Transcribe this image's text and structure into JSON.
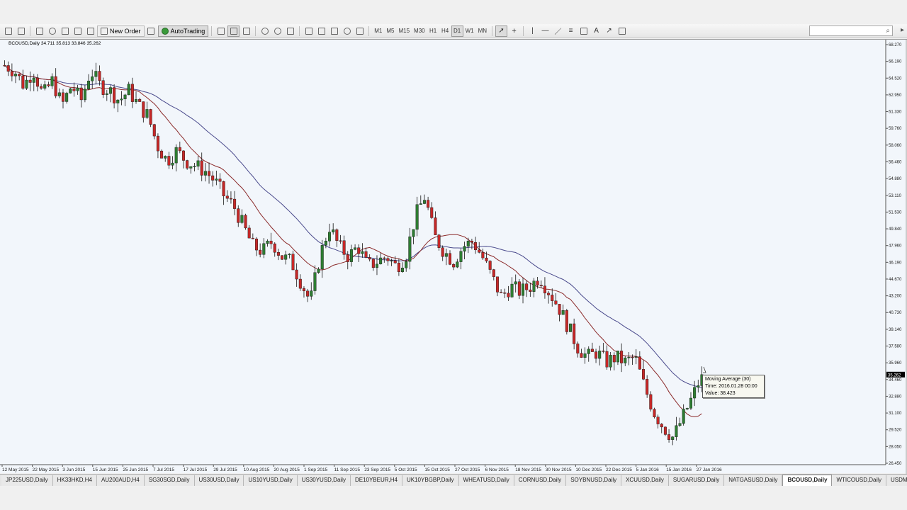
{
  "toolbar": {
    "new_order_label": "New Order",
    "autotrading_label": "AutoTrading",
    "timeframes": [
      "M1",
      "M5",
      "M15",
      "M30",
      "H1",
      "H4",
      "D1",
      "W1",
      "MN"
    ],
    "active_timeframe": "D1",
    "search_placeholder": ""
  },
  "chart": {
    "title": "BCOUSD,Daily  34.711 35.813 33.846 35.262",
    "background": "#f2f6fb",
    "bull_color": "#2e7d32",
    "bear_color": "#c62828",
    "ma_fast_color": "#8b2a2a",
    "ma_slow_color": "#4a4a8c",
    "current_price_label": "35.262",
    "y_ticks": [
      "68.270",
      "66.190",
      "64.520",
      "62.950",
      "61.330",
      "59.760",
      "58.060",
      "56.460",
      "54.880",
      "53.110",
      "51.530",
      "49.840",
      "47.960",
      "46.190",
      "44.670",
      "43.200",
      "40.730",
      "39.140",
      "37.580",
      "35.960",
      "34.460",
      "32.880",
      "31.100",
      "29.520",
      "28.050",
      "26.450"
    ],
    "x_ticks": [
      "12 May 2015",
      "22 May 2015",
      "3 Jun 2015",
      "15 Jun 2015",
      "25 Jun 2015",
      "7 Jul 2015",
      "17 Jul 2015",
      "29 Jul 2015",
      "10 Aug 2015",
      "20 Aug 2015",
      "1 Sep 2015",
      "11 Sep 2015",
      "23 Sep 2015",
      "5 Oct 2015",
      "15 Oct 2015",
      "27 Oct 2015",
      "6 Nov 2015",
      "18 Nov 2015",
      "30 Nov 2015",
      "10 Dec 2015",
      "22 Dec 2015",
      "5 Jan 2016",
      "15 Jan 2016",
      "27 Jan 2016"
    ]
  },
  "chart_data": {
    "type": "candlestick",
    "symbol": "BCOUSD",
    "timeframe": "Daily",
    "last": {
      "open": 34.711,
      "high": 35.813,
      "low": 33.846,
      "close": 35.262
    },
    "ylim": [
      26.45,
      68.27
    ],
    "close_path": [
      66.0,
      65.5,
      64.0,
      65.5,
      63.0,
      64.5,
      62.0,
      64.0,
      62.5,
      65.5,
      64.0,
      63.5,
      62.5,
      63.5,
      62.0,
      61.0,
      58.0,
      56.5,
      57.5,
      56.5,
      56.0,
      55.5,
      54.5,
      53.0,
      52.0,
      50.0,
      48.0,
      47.5,
      48.5,
      47.0,
      46.5,
      44.5,
      42.5,
      47.0,
      50.0,
      48.0,
      47.0,
      48.0,
      46.0,
      46.5,
      47.0,
      46.0,
      47.0,
      51.0,
      53.0,
      49.0,
      47.5,
      46.5,
      48.0,
      48.5,
      47.0,
      45.0,
      43.0,
      44.0,
      43.5,
      44.0,
      45.0,
      43.5,
      42.0,
      40.0,
      38.0,
      37.0,
      37.5,
      36.5,
      37.0,
      36.5,
      37.0,
      34.0,
      31.5,
      30.0,
      29.0,
      31.0,
      33.0,
      35.26
    ]
  },
  "tooltip": {
    "line1": "Moving Average (30)",
    "line2": "Time: 2016.01.28 00:00",
    "line3": "Value: 38.423"
  },
  "tabs": [
    "JP225USD,Daily",
    "HK33HKD,H4",
    "AU200AUD,H4",
    "SG30SGD,Daily",
    "US30USD,Daily",
    "US10YUSD,Daily",
    "US30YUSD,Daily",
    "DE10YBEUR,H4",
    "UK10YBGBP,Daily",
    "WHEATUSD,Daily",
    "CORNUSD,Daily",
    "SOYBNUSD,Daily",
    "XCUUSD,Daily",
    "SUGARUSD,Daily",
    "NATGASUSD,Daily",
    "BCOUSD,Daily",
    "WTICOUSD,Daily",
    "USDMXN"
  ],
  "active_tab": "BCOUSD,Daily"
}
